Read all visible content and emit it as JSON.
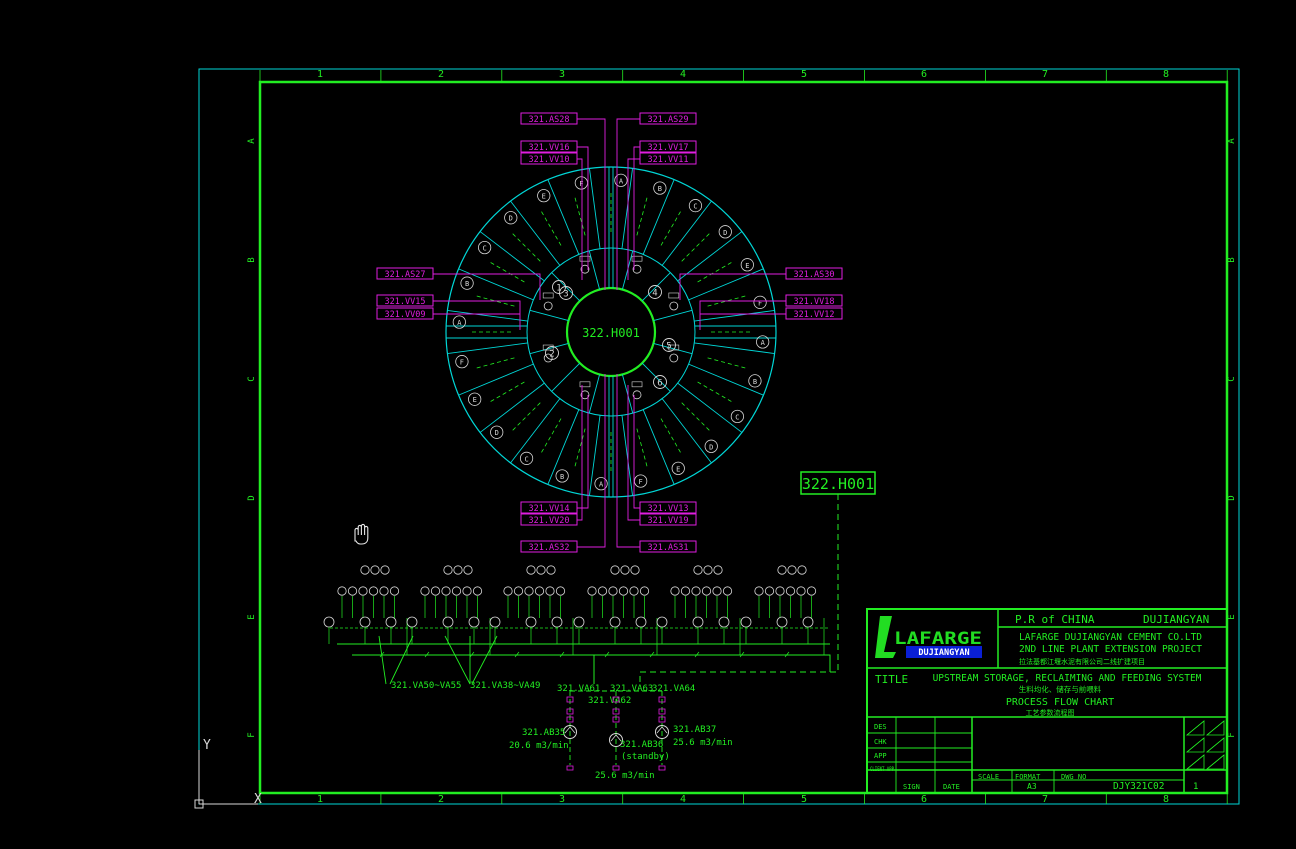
{
  "colors": {
    "background": "#000000",
    "cyan": "#00d6d6",
    "green": "#22ee22",
    "magenta": "#e01ee0",
    "white": "#d8d8d8",
    "lafarge_green": "#22dd22",
    "lafarge_blue": "#0a1fd6"
  },
  "drawing": {
    "grid_cols": [
      "1",
      "2",
      "3",
      "4",
      "5",
      "6",
      "7",
      "8"
    ],
    "grid_rows": [
      "A",
      "B",
      "C",
      "D",
      "E",
      "F"
    ],
    "center_label": "322.H001",
    "callout_label": "322.H001",
    "tags_magenta": [
      "321.AS28",
      "321.AS29",
      "321.VV16",
      "321.VV10",
      "321.VV17",
      "321.VV11",
      "321.AS27",
      "321.AS30",
      "321.VV15",
      "321.VV09",
      "321.VV18",
      "321.VV12",
      "321.VV14",
      "321.VV20",
      "321.VV13",
      "321.VV19",
      "321.AS32",
      "321.AS31"
    ],
    "silo_numbers": [
      "1",
      "2",
      "3",
      "4",
      "5",
      "6"
    ],
    "lower_tags": [
      "321.VA50~VA55",
      "321.VA38~VA49",
      "321.VA61",
      "321.VA62",
      "321.VA63",
      "321.VA64"
    ],
    "pumps": [
      {
        "tag": "321.AB35",
        "rate": "20.6 m3/min"
      },
      {
        "tag": "321.AB36",
        "note": "(standby)",
        "rate": "25.6 m3/min"
      },
      {
        "tag": "321.AB37",
        "rate": "25.6 m3/min"
      }
    ],
    "ucs": {
      "y": "Y",
      "x": "X"
    }
  },
  "title_block": {
    "country": "P.R of CHINA",
    "city": "DUJIANGYAN",
    "company_line1": "LAFARGE DUJIANGYAN CEMENT CO.LTD",
    "company_line2": "2ND LINE PLANT EXTENSION PROJECT",
    "company_cn": "拉法基都江堰水泥有限公司二线扩建项目",
    "logo_word": "LAFARGE",
    "logo_sub": "DUJIANGYAN",
    "title_label": "TITLE",
    "title_en1": "UPSTREAM STORAGE, RECLAIMING AND FEEDING SYSTEM",
    "title_cn1": "生料均化、储存与前喂料",
    "title_en2": "PROCESS FLOW CHART",
    "title_cn2": "工艺参数流程图",
    "rows": [
      "DES",
      "CHK",
      "APP",
      "CLIENT APP"
    ],
    "sign": "SIGN",
    "date": "DATE",
    "scale": "SCALE",
    "format": "FORMAT",
    "format_val": "A3",
    "dwg_no": "DWG NO",
    "dwg_val": "DJY321C02",
    "sheet": "1"
  }
}
